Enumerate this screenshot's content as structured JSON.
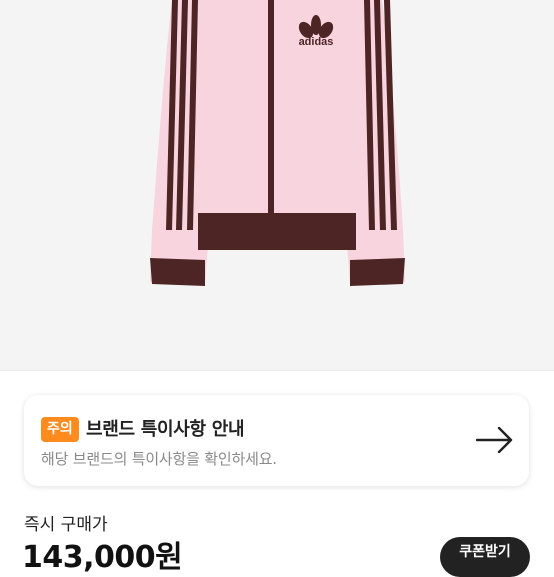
{
  "product": {
    "image_alt": "adidas pink track jacket with brown stripes",
    "logo_text": "adidas"
  },
  "notice": {
    "badge": "주의",
    "title": "브랜드 특이사항 안내",
    "description": "해당 브랜드의 특이사항을 확인하세요."
  },
  "purchase": {
    "label": "즉시 구매가",
    "price": "143,000원",
    "coupon_label": "쿠폰받기"
  },
  "colors": {
    "jacket_pink": "#f7d4de",
    "stripe_brown": "#4e2525",
    "badge_orange": "#ff8a1e"
  },
  "icons": {
    "notice_arrow": "arrow-right-icon"
  }
}
